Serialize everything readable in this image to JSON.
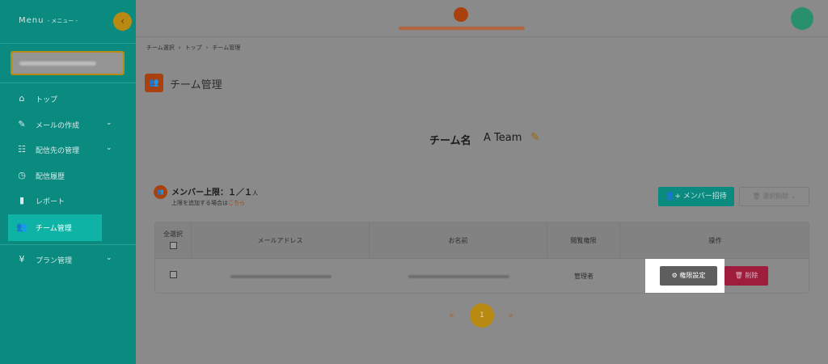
{
  "sidebar": {
    "menu_title": "Menu",
    "menu_subtitle": "- メニュー -",
    "collapse_glyph": "‹",
    "items": [
      {
        "label": "トップ",
        "icon": "home-icon",
        "glyph": "⌂",
        "has_submenu": false
      },
      {
        "label": "メールの作成",
        "icon": "pencil-icon",
        "glyph": "✎",
        "has_submenu": true
      },
      {
        "label": "配信先の管理",
        "icon": "contacts-icon",
        "glyph": "☷",
        "has_submenu": true
      },
      {
        "label": "配信履歴",
        "icon": "history-icon",
        "glyph": "◷",
        "has_submenu": false
      },
      {
        "label": "レポート",
        "icon": "bar-chart-icon",
        "glyph": "▮",
        "has_submenu": false
      },
      {
        "label": "チーム管理",
        "icon": "group-icon",
        "glyph": "👥",
        "has_submenu": false,
        "active": true
      },
      {
        "label": "プラン管理",
        "icon": "yen-icon",
        "glyph": "¥",
        "has_submenu": true
      }
    ],
    "chevron_glyph": "⌄"
  },
  "breadcrumb": [
    "チーム選択",
    "トップ",
    "チーム管理"
  ],
  "breadcrumb_sep": "›",
  "page": {
    "title": "チーム管理",
    "title_icon_glyph": "👥"
  },
  "team": {
    "name_label": "チーム名",
    "name_value": "A Team",
    "edit_glyph": "✎"
  },
  "limit": {
    "label": "メンバー上限：１／１",
    "unit": "人",
    "note": "上限を追加する場合は",
    "link": "こちら",
    "icon_glyph": "👥"
  },
  "buttons": {
    "invite": "👤+ メンバー招待",
    "bulk_delete": "🗑 選択削除 ⌄"
  },
  "table": {
    "headers": [
      "全選択",
      "メールアドレス",
      "お名前",
      "閲覧権限",
      "操作"
    ],
    "rows": [
      {
        "permission": "管理者"
      }
    ]
  },
  "actions": {
    "permission_settings": "⚙ 権限設定",
    "delete": "🗑 削除"
  },
  "pagination": {
    "prev": "«",
    "current": "1",
    "next": "»"
  },
  "colors": {
    "sidebar": "#0b8a80",
    "accent_orange": "#a8410d",
    "accent_gold": "#b98a12",
    "danger": "#9e1c3c"
  }
}
